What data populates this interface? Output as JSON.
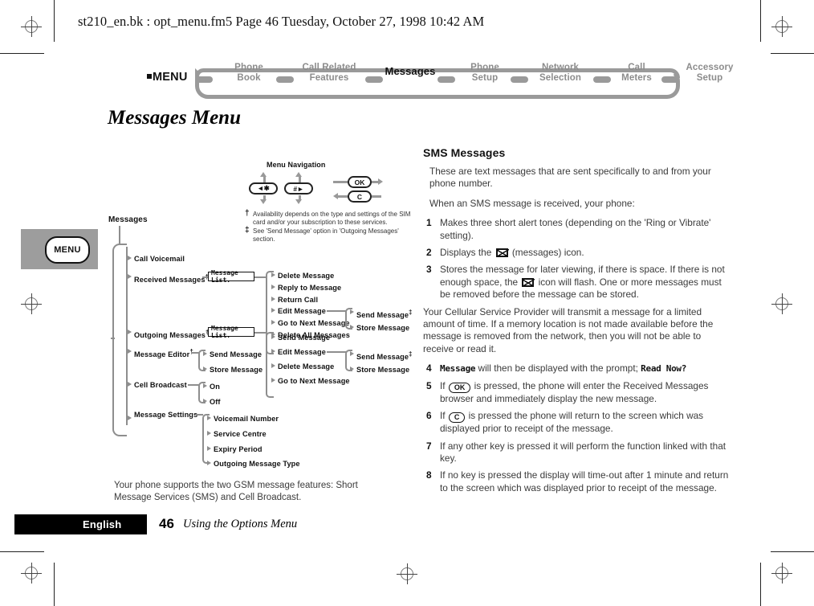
{
  "running_header": "st210_en.bk : opt_menu.fm5  Page 46  Tuesday, October 27, 1998  10:42 AM",
  "navbar": {
    "menu_label": "MENU",
    "items": [
      {
        "line1": "Phone",
        "line2": "Book",
        "active": false
      },
      {
        "line1": "Call Related",
        "line2": "Features",
        "active": false
      },
      {
        "line1": "Messages",
        "line2": "",
        "active": true
      },
      {
        "line1": "Phone",
        "line2": "Setup",
        "active": false
      },
      {
        "line1": "Network",
        "line2": "Selection",
        "active": false
      },
      {
        "line1": "Call",
        "line2": "Meters",
        "active": false
      },
      {
        "line1": "Accessory",
        "line2": "Setup",
        "active": false
      }
    ]
  },
  "chapter_title": "Messages Menu",
  "menu_tab_key": "MENU",
  "legend": {
    "title": "Menu Navigation",
    "key_star": "◄✱",
    "key_hash": "#►",
    "key_ok": "OK",
    "key_c": "C",
    "footnote_dagger_symbol": "†",
    "footnote_dagger": "Availability depends on the type and settings of the SIM card and/or your subscription to these services.",
    "footnote_dbldagger_symbol": "‡",
    "footnote_dbldagger": "See 'Send Message' option in 'Outgoing Messages' section."
  },
  "tree": {
    "root": "Messages",
    "level1": [
      {
        "label": "Call Voicemail",
        "dagger": ""
      },
      {
        "label": "Received Messages",
        "dagger": "†"
      },
      {
        "label": "Outgoing Messages",
        "dagger": "†"
      },
      {
        "label": "Message Editor",
        "dagger": "†"
      },
      {
        "label": "Cell Broadcast",
        "dagger": ""
      },
      {
        "label": "Message Settings",
        "dagger": ""
      }
    ],
    "lcd_received": "Message List.",
    "lcd_outgoing": "Message List.",
    "received_children": [
      "Delete Message",
      "Reply to Message",
      "Return Call",
      "Edit Message",
      "Go to Next Message",
      "Delete All Messages"
    ],
    "received_edit_children": [
      {
        "label": "Send Message",
        "dagger": "‡"
      },
      {
        "label": "Store Message",
        "dagger": ""
      }
    ],
    "outgoing_children": [
      "Send Message",
      "Edit Message",
      "Delete Message",
      "Go to Next Message"
    ],
    "outgoing_edit_children": [
      {
        "label": "Send Message",
        "dagger": "‡"
      },
      {
        "label": "Store Message",
        "dagger": ""
      }
    ],
    "editor_children": [
      "Send Message",
      "Store Message"
    ],
    "broadcast_children": [
      "On",
      "Off"
    ],
    "settings_children": [
      "Voicemail Number",
      "Service Centre",
      "Expiry Period",
      "Outgoing Message Type"
    ]
  },
  "caption": "Your phone supports the two GSM  message features: Short Message Services (SMS) and Cell Broadcast.",
  "right": {
    "heading": "SMS Messages",
    "p1": "These are text messages that are sent specifically to and from your phone number.",
    "p2": "When an SMS message is received, your phone:",
    "step1_num": "1",
    "step1": "Makes three short alert tones (depending on the 'Ring or Vibrate' setting).",
    "step2_num": "2",
    "step2_a": "Displays the",
    "step2_b": "(messages) icon.",
    "step3_num": "3",
    "step3_a": "Stores the message for later viewing, if there is space. If there is not enough space, the",
    "step3_b": "icon will flash. One or more messages must be removed before the message can be stored.",
    "p3": "Your Cellular Service Provider will transmit a message for a limited amount of time. If a memory location is not made available before the message is removed from the network, then you will not be able to receive or read it.",
    "step4_num": "4",
    "step4_lcd1": "Message",
    "step4_mid": "will then be displayed with the prompt;",
    "step4_lcd2": "Read Now?",
    "step5_num": "5",
    "step5_a": "If",
    "step5_key": "OK",
    "step5_b": "is pressed, the phone will enter the Received Messages browser and immediately display the new message.",
    "step6_num": "6",
    "step6_a": "If",
    "step6_key": "C",
    "step6_b": "is pressed the phone will return to the screen which was displayed prior to receipt of the message.",
    "step7_num": "7",
    "step7": "If any other key is pressed it will perform the function linked with that key.",
    "step8_num": "8",
    "step8": "If no key is pressed the display will time-out after 1 minute and return to the screen which was displayed prior to receipt of the message."
  },
  "footer": {
    "language": "English",
    "page_number": "46",
    "section": "Using the Options Menu"
  }
}
